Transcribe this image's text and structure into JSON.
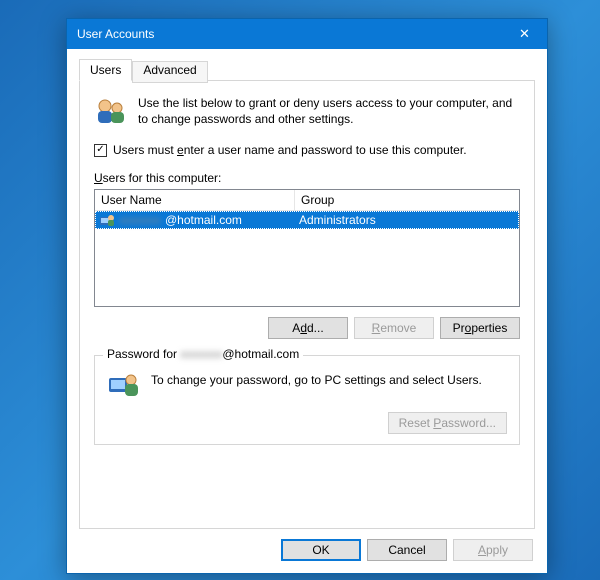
{
  "window": {
    "title": "User Accounts"
  },
  "tabs": {
    "users": "Users",
    "advanced": "Advanced"
  },
  "intro": "Use the list below to grant or deny users access to your computer, and to change passwords and other settings.",
  "checkbox": {
    "checked": true,
    "prefix": "Users must ",
    "hotkey": "e",
    "suffix": "nter a user name and password to use this computer."
  },
  "listLabel": {
    "hotkey": "U",
    "rest": "sers for this computer:"
  },
  "columns": {
    "user": "User Name",
    "group": "Group"
  },
  "rows": [
    {
      "emailHidden": "xxxxxxx",
      "emailDomain": "@hotmail.com",
      "group": "Administrators",
      "selected": true
    }
  ],
  "buttons": {
    "add": "Add...",
    "remove": "Remove",
    "properties": "Properties",
    "resetPassword": "Reset Password...",
    "ok": "OK",
    "cancel": "Cancel",
    "apply": "Apply"
  },
  "passwordGroup": {
    "legendPrefix": "Password for ",
    "legendHidden": "xxxxxxx",
    "legendDomain": "@hotmail.com",
    "text": "To change your password, go to PC settings and select Users."
  }
}
